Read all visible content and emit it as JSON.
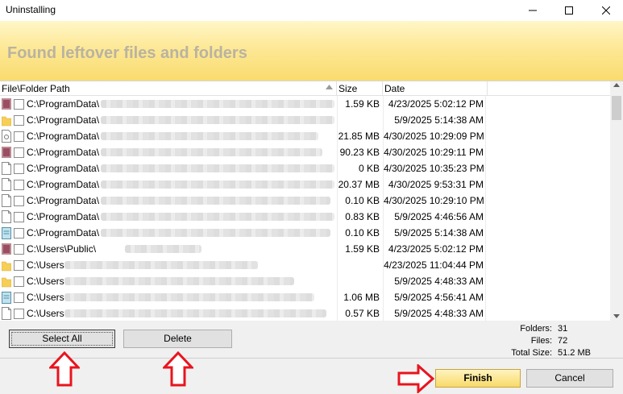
{
  "window": {
    "title": "Uninstalling"
  },
  "banner": {
    "heading": "Found leftover files and folders"
  },
  "columns": {
    "path": "File\\Folder Path",
    "size": "Size",
    "date": "Date"
  },
  "rows": [
    {
      "icon": "file-colored-icon",
      "path": "C:\\ProgramData\\",
      "size": "1.59 KB",
      "date": "4/23/2025   5:02:12 PM"
    },
    {
      "icon": "folder-icon",
      "path": "C:\\ProgramData\\",
      "size": "",
      "date": "5/9/2025   5:14:38 AM"
    },
    {
      "icon": "config-file-icon",
      "path": "C:\\ProgramData\\",
      "size": "21.85 MB",
      "date": "4/30/2025   10:29:09 PM"
    },
    {
      "icon": "file-colored-icon",
      "path": "C:\\ProgramData\\",
      "size": "90.23 KB",
      "date": "4/30/2025   10:29:11 PM"
    },
    {
      "icon": "blank-file-icon",
      "path": "C:\\ProgramData\\",
      "size": "0 KB",
      "date": "4/30/2025   10:35:23 PM"
    },
    {
      "icon": "blank-file-icon",
      "path": "C:\\ProgramData\\",
      "size": "20.37 MB",
      "date": "4/30/2025   9:53:31 PM"
    },
    {
      "icon": "blank-file-icon",
      "path": "C:\\ProgramData\\",
      "size": "0.10 KB",
      "date": "4/30/2025   10:29:10 PM"
    },
    {
      "icon": "blank-file-icon",
      "path": "C:\\ProgramData\\",
      "size": "0.83 KB",
      "date": "5/9/2025   4:46:56 AM"
    },
    {
      "icon": "notepad-file-icon",
      "path": "C:\\ProgramData\\",
      "size": "0.10 KB",
      "date": "5/9/2025   5:14:38 AM"
    },
    {
      "icon": "file-colored-icon",
      "path": "C:\\Users\\Public\\",
      "size": "1.59 KB",
      "date": "4/23/2025   5:02:12 PM"
    },
    {
      "icon": "folder-icon",
      "path": "C:\\Users",
      "size": "",
      "date": "4/23/2025   11:04:44 PM"
    },
    {
      "icon": "folder-icon",
      "path": "C:\\Users",
      "size": "",
      "date": "5/9/2025   4:48:33 AM"
    },
    {
      "icon": "notepad-file-icon",
      "path": "C:\\Users",
      "size": "1.06 MB",
      "date": "5/9/2025   4:56:41 AM"
    },
    {
      "icon": "blank-file-icon",
      "path": "C:\\Users",
      "size": "0.57 KB",
      "date": "5/9/2025   4:48:33 AM"
    }
  ],
  "buttons": {
    "select_all": "Select All",
    "delete": "Delete",
    "finish": "Finish",
    "cancel": "Cancel"
  },
  "stats": {
    "folders_label": "Folders:",
    "folders_value": "31",
    "files_label": "Files:",
    "files_value": "72",
    "total_label": "Total Size:",
    "total_value": "51.2 MB"
  },
  "colors": {
    "banner_top": "#fff7c8",
    "banner_bottom": "#f9db6e",
    "annotation_arrow": "#e8141e",
    "heading_text": "#b9b3a1"
  }
}
